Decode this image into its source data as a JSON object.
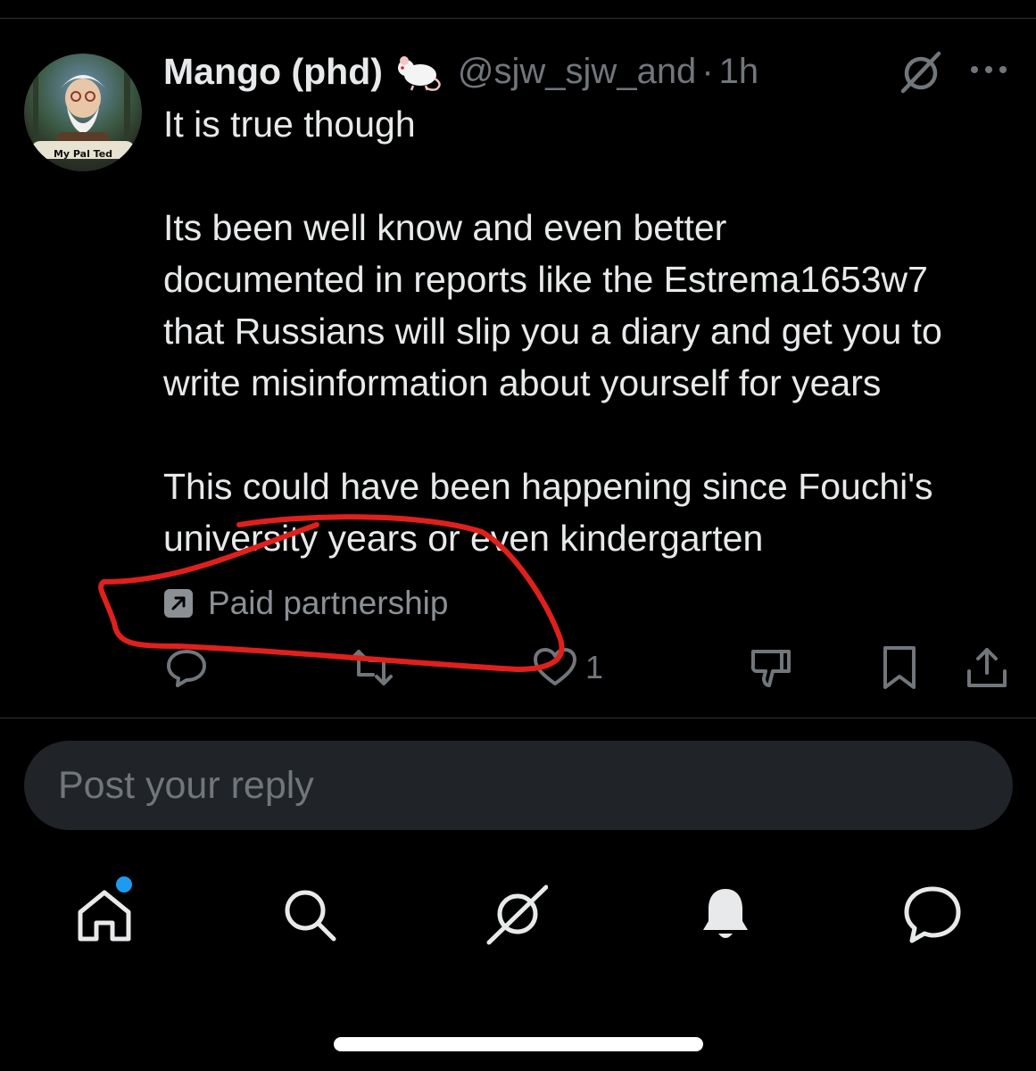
{
  "post": {
    "author_name": "Mango (phd)",
    "handle": "@sjw_sjw_and",
    "separator": "·",
    "time": "1h",
    "avatar_caption": "My Pal Ted",
    "paragraphs": [
      [
        "It is true though"
      ],
      [
        "Its been well know and even better",
        "documented in reports like the Estrema1653w7",
        "that Russians will slip you a diary and get you to",
        "write misinformation about yourself for years"
      ],
      [
        "This could have been happening since Fouchi's",
        "university years or even kindergarten"
      ]
    ],
    "paid_label": "Paid partnership",
    "like_count": "1"
  },
  "reply": {
    "placeholder": "Post your reply"
  },
  "icons": {
    "name_emoji": "mouse-icon",
    "grok": "grok-icon",
    "more": "more-icon",
    "paid": "external-link-icon",
    "actions": [
      "reply-icon",
      "retweet-icon",
      "heart-icon",
      "dislike-icon",
      "bookmark-icon",
      "share-icon"
    ],
    "nav": [
      "home-icon",
      "search-icon",
      "grok-icon",
      "notifications-bell-icon",
      "messages-icon"
    ]
  },
  "colors": {
    "background": "#000000",
    "text_primary": "#e7e9ea",
    "text_secondary": "#71767b",
    "accent": "#1d9bf0",
    "annotation": "#e0201c"
  }
}
